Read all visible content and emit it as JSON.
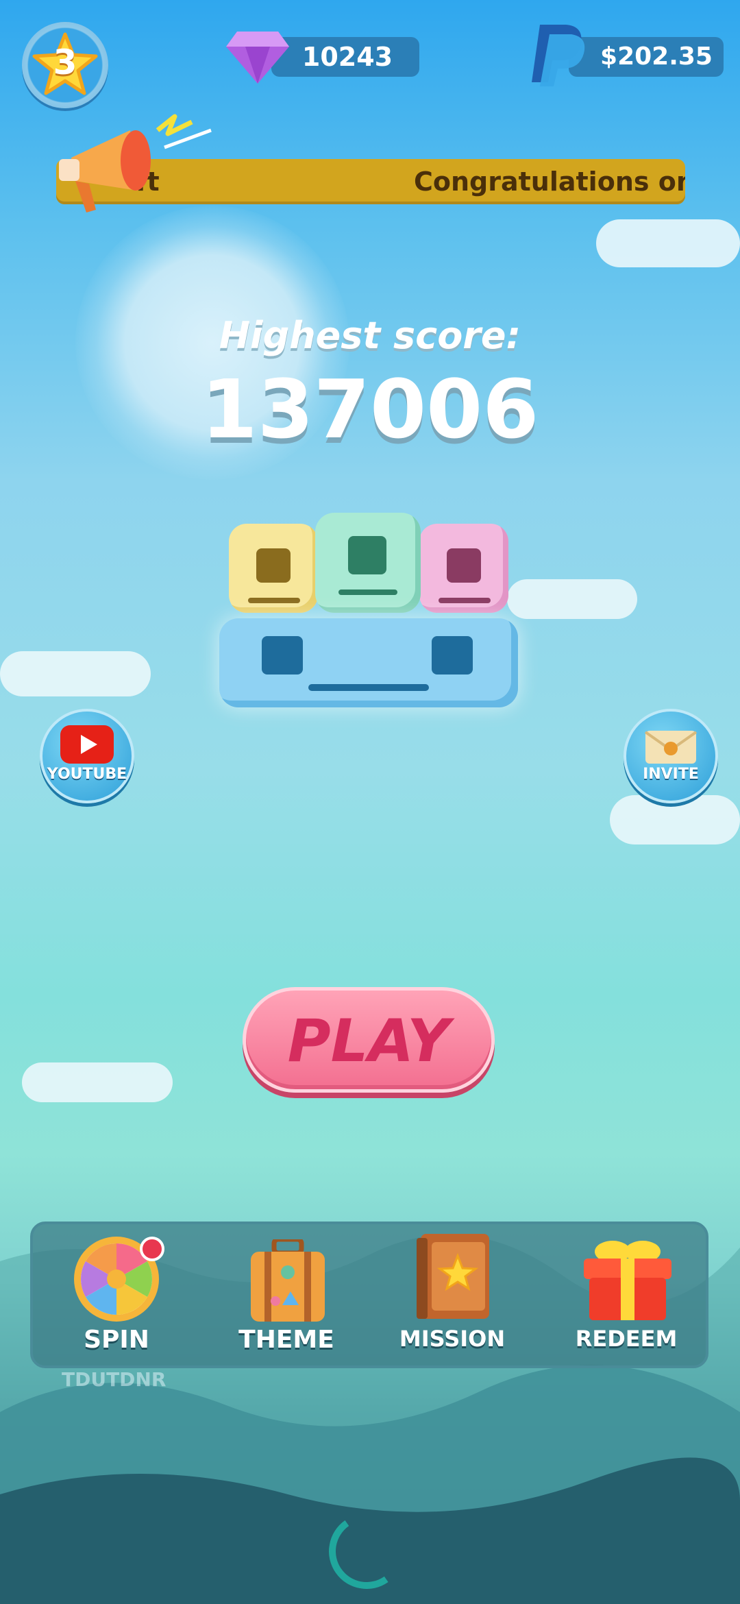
{
  "hud": {
    "level": "3",
    "gems": "10243",
    "cash": "$202.35"
  },
  "ticker": {
    "left_fragment": "ft",
    "message": "Congratulations on V"
  },
  "score": {
    "label": "Highest score:",
    "value": "137006"
  },
  "side_buttons": {
    "youtube": "YOUTUBE",
    "invite": "INVITE"
  },
  "play_label": "PLAY",
  "dock": {
    "items": [
      {
        "label": "SPIN",
        "icon": "spin-wheel-icon"
      },
      {
        "label": "THEME",
        "icon": "suitcase-icon"
      },
      {
        "label": "MISSION",
        "icon": "mission-book-icon"
      },
      {
        "label": "REDEEM",
        "icon": "gift-box-icon"
      }
    ]
  },
  "watermark": "TDUTDNR",
  "colors": {
    "play_pink": "#f36f90",
    "ticker_gold": "#d2a51e",
    "pill_blue": "#2b7fb7"
  }
}
